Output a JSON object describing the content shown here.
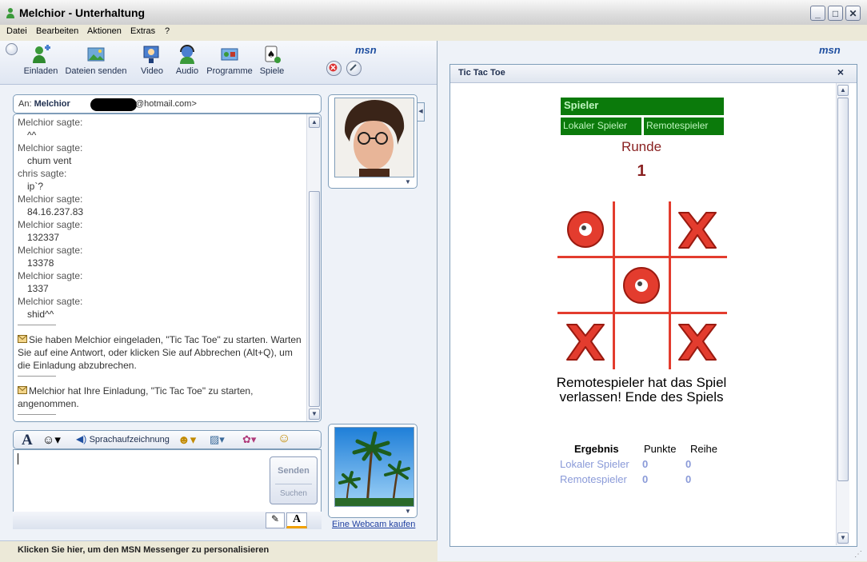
{
  "window": {
    "title": "Melchior - Unterhaltung"
  },
  "menu": [
    "Datei",
    "Bearbeiten",
    "Aktionen",
    "Extras",
    "?"
  ],
  "toolbar": {
    "items": [
      {
        "label": "Einladen",
        "icon": "invite-icon"
      },
      {
        "label": "Dateien senden",
        "icon": "send-files-icon"
      },
      {
        "label": "Video",
        "icon": "video-icon"
      },
      {
        "label": "Audio",
        "icon": "audio-icon"
      },
      {
        "label": "Programme",
        "icon": "programs-icon"
      },
      {
        "label": "Spiele",
        "icon": "games-icon"
      }
    ],
    "brand": "msn"
  },
  "conversation": {
    "to_prefix": "An:",
    "to_name": "Melchior",
    "to_email_tail": "@hotmail.com>",
    "log": [
      {
        "type": "sender",
        "text": "Melchior sagte:"
      },
      {
        "type": "msg",
        "text": "^^"
      },
      {
        "type": "sender",
        "text": "Melchior sagte:"
      },
      {
        "type": "msg",
        "text": "chum vent"
      },
      {
        "type": "sender",
        "text": "chris sagte:"
      },
      {
        "type": "msg",
        "text": "ip`?"
      },
      {
        "type": "sender",
        "text": "Melchior sagte:"
      },
      {
        "type": "msg",
        "text": "84.16.237.83"
      },
      {
        "type": "sender",
        "text": "Melchior sagte:"
      },
      {
        "type": "msg",
        "text": "132337"
      },
      {
        "type": "sender",
        "text": "Melchior sagte:"
      },
      {
        "type": "msg",
        "text": "13378"
      },
      {
        "type": "sender",
        "text": "Melchior sagte:"
      },
      {
        "type": "msg",
        "text": "1337"
      },
      {
        "type": "sender",
        "text": "Melchior sagte:"
      },
      {
        "type": "msg",
        "text": "shid^^"
      }
    ],
    "system1": "Sie haben Melchior eingeladen, \"Tic Tac Toe\" zu starten. Warten Sie auf eine Antwort, oder klicken Sie auf Abbrechen (Alt+Q), um die Einladung abzubrechen.",
    "system2": "Melchior hat Ihre Einladung, \"Tic Tac Toe\" zu starten, angenommen."
  },
  "compose": {
    "voice_clip": "Sprachaufzeichnung",
    "send": "Senden",
    "search": "Suchen"
  },
  "webcam_link": "Eine Webcam kaufen",
  "status_text": "Klicken Sie hier, um den MSN Messenger zu personalisieren",
  "game": {
    "title": "Tic Tac Toe",
    "brand": "msn",
    "players_header": "Spieler",
    "local_player": "Lokaler Spieler",
    "remote_player": "Remotespieler",
    "round_label": "Runde",
    "round_value": "1",
    "board": [
      "O",
      "",
      "X",
      "",
      "O",
      "",
      "X",
      "",
      "X"
    ],
    "message": "Remotespieler hat das Spiel verlassen! Ende des Spiels",
    "results": {
      "header": "Ergebnis",
      "col_points": "Punkte",
      "col_row": "Reihe",
      "rows": [
        {
          "name": "Lokaler Spieler",
          "points": "0",
          "row": "0"
        },
        {
          "name": "Remotespieler",
          "points": "0",
          "row": "0"
        }
      ]
    }
  },
  "colors": {
    "green": "#0b7a0b",
    "board_red": "#e33c2e",
    "accent_blue": "#1f2f4f"
  }
}
